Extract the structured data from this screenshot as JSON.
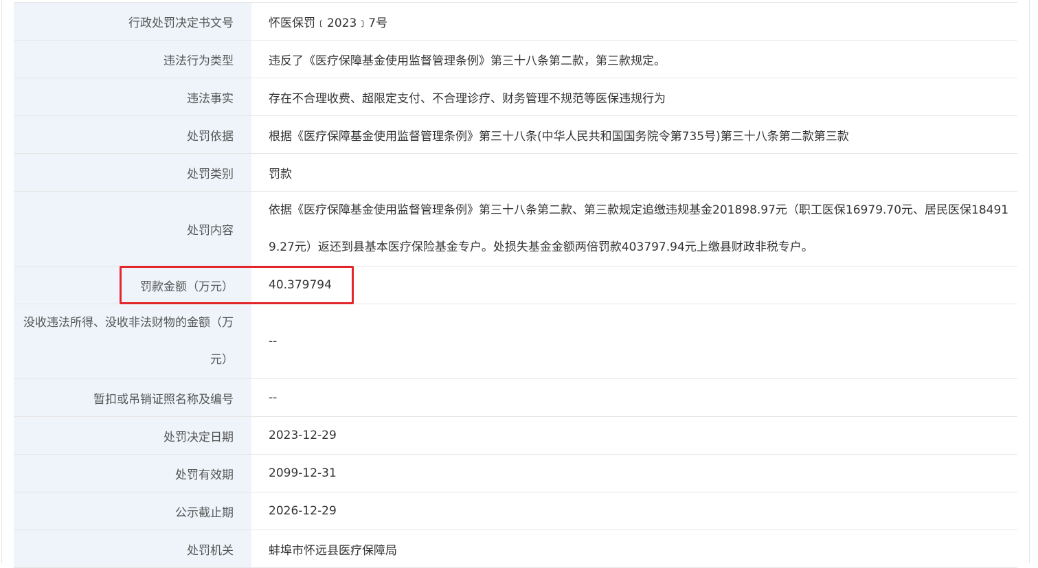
{
  "rows": [
    {
      "label": "行政处罚决定书文号",
      "value": "怀医保罚﹝2023﹞7号"
    },
    {
      "label": "违法行为类型",
      "value": "违反了《医疗保障基金使用监督管理条例》第三十八条第二款，第三款规定。"
    },
    {
      "label": "违法事实",
      "value": "存在不合理收费、超限定支付、不合理诊疗、财务管理不规范等医保违规行为"
    },
    {
      "label": "处罚依据",
      "value": "根据《医疗保障基金使用监督管理条例》第三十八条(中华人民共和国国务院令第735号)第三十八条第二款第三款"
    },
    {
      "label": "处罚类别",
      "value": "罚款"
    },
    {
      "label": "处罚内容",
      "value": "依据《医疗保障基金使用监督管理条例》第三十八条第二款、第三款规定追缴违规基金201898.97元（职工医保16979.70元、居民医保184919.27元）返还到县基本医疗保险基金专户。处损失基金金额两倍罚款403797.94元上缴县财政非税专户。"
    },
    {
      "label": "罚款金额（万元）",
      "value": "40.379794"
    },
    {
      "label": "没收违法所得、没收非法财物的金额（万元）",
      "value": "--"
    },
    {
      "label": "暂扣或吊销证照名称及编号",
      "value": "--"
    },
    {
      "label": "处罚决定日期",
      "value": "2023-12-29"
    },
    {
      "label": "处罚有效期",
      "value": "2099-12-31"
    },
    {
      "label": "公示截止期",
      "value": "2026-12-29"
    },
    {
      "label": "处罚机关",
      "value": "蚌埠市怀远县医疗保障局"
    }
  ],
  "highlight_color": "#e3262a",
  "label_bg": "#eef4fa"
}
